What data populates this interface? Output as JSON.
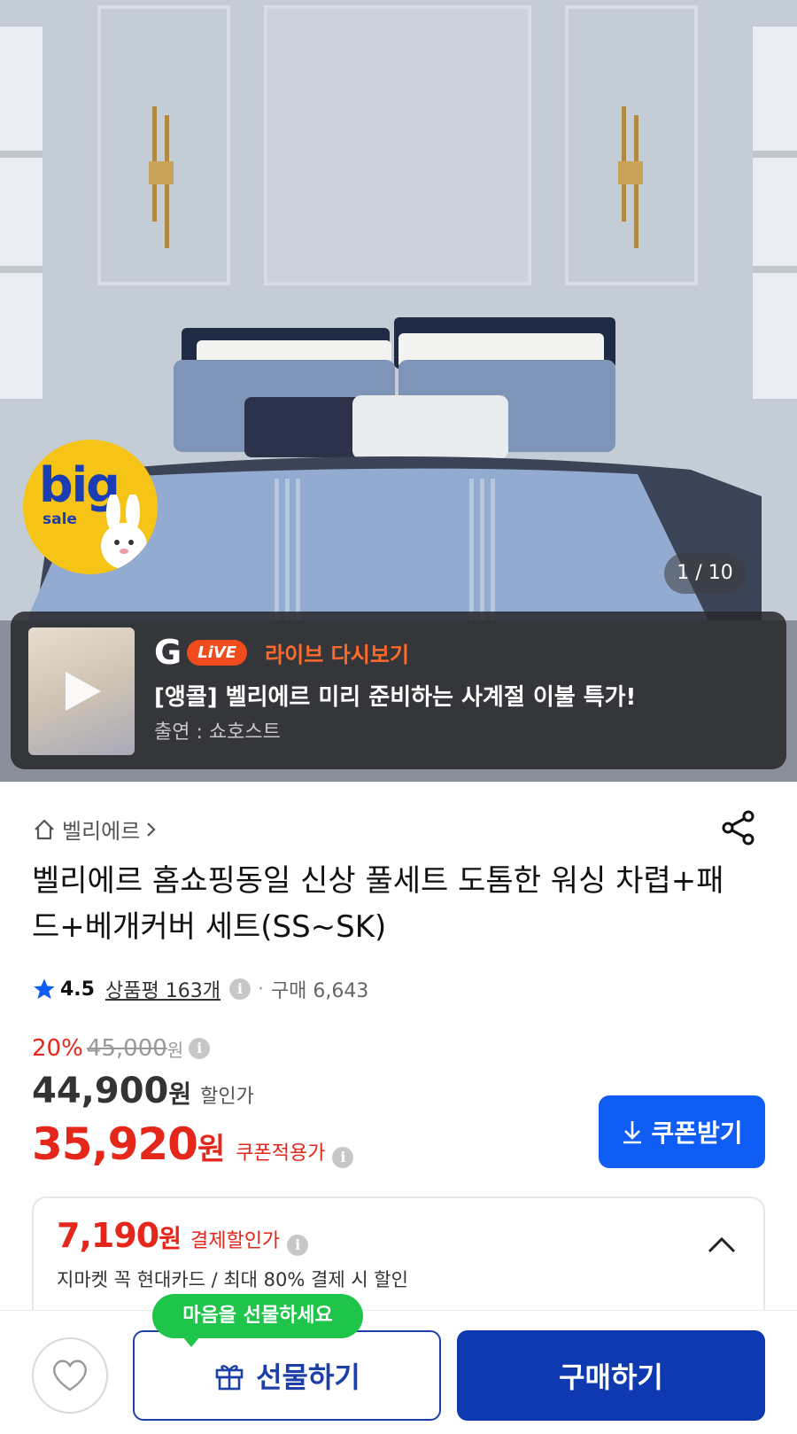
{
  "hero": {
    "image_alt_icon": "bedding-product-photo",
    "badge": {
      "big": "big",
      "sale": "sale"
    },
    "counter": "1 / 10"
  },
  "live": {
    "logo_g": "G",
    "logo_live": "LiVE",
    "replay_label": "라이브 다시보기",
    "title": "[앵콜] 벨리에르 미리 준비하는 사계절 이불 특가!",
    "host": "출연 : 쇼호스트"
  },
  "product": {
    "brand": "벨리에르",
    "title": "벨리에르 홈쇼핑동일 신상 풀세트 도톰한 워싱 차렵+패드+베개커버 세트(SS~SK)",
    "rating": "4.5",
    "reviews": "상품평 163개",
    "purchases": "구매 6,643"
  },
  "price": {
    "discount_pct": "20%",
    "original": "45,000",
    "original_unit": "원",
    "sale": "44,900",
    "sale_unit": "원",
    "sale_label": "할인가",
    "coupon": "35,920",
    "coupon_unit": "원",
    "coupon_label": "쿠폰적용가",
    "coupon_button": "쿠폰받기"
  },
  "payment_discount": {
    "amount": "7,190",
    "unit": "원",
    "label": "결제할인가",
    "description": "지마켓 꼭 현대카드 / 최대 80% 결제 시 할인"
  },
  "bottom": {
    "gift_tooltip": "마음을 선물하세요",
    "gift_button": "선물하기",
    "buy_button": "구매하기"
  },
  "colors": {
    "accent_blue": "#0f5df5",
    "buy_navy": "#0f39b0",
    "price_red": "#e5261b",
    "live_orange": "#f04b1d",
    "tooltip_green": "#1fc44a"
  }
}
